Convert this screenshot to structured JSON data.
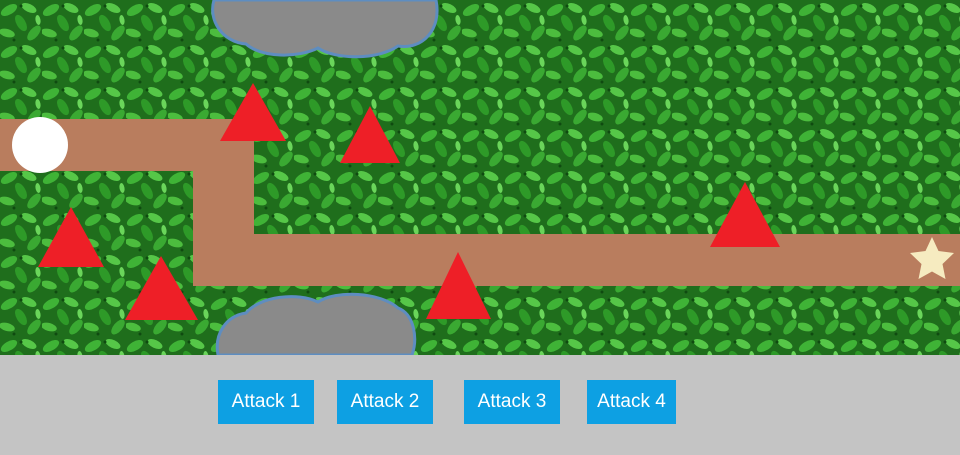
{
  "colors": {
    "grass": "#2f8a2a",
    "path": "#b97d5e",
    "tower": "#ee1f27",
    "enemy": "#ffffff",
    "goal": "#f6ebc0",
    "cloud_fill": "#8a8a8a",
    "cloud_stroke": "#5e8dc0",
    "button": "#0da0e3",
    "panel": "#c4c4c4"
  },
  "icons": {
    "enemy": "white-circle-enemy",
    "tower": "red-triangle-tower",
    "goal": "star-icon",
    "obstacle": "cloud-icon"
  },
  "controls": {
    "buttons": [
      {
        "label": "Attack 1"
      },
      {
        "label": "Attack 2"
      },
      {
        "label": "Attack 3"
      },
      {
        "label": "Attack 4"
      }
    ]
  }
}
